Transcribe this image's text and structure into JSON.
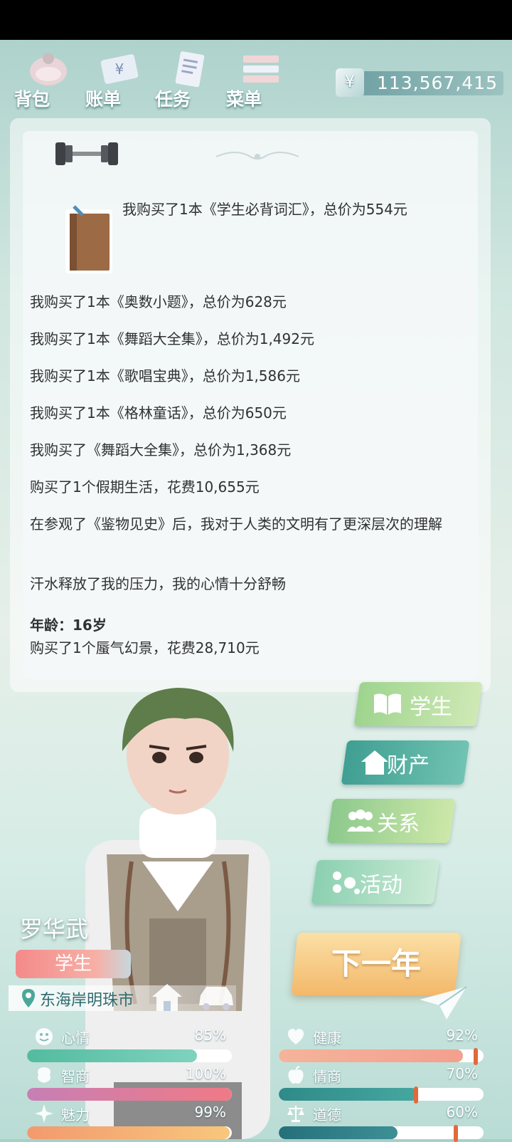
{
  "topbar": {
    "items": [
      {
        "label": "背包",
        "icon": "backpack-icon"
      },
      {
        "label": "账单",
        "icon": "bill-icon"
      },
      {
        "label": "任务",
        "icon": "task-icon"
      },
      {
        "label": "菜单",
        "icon": "menu-icon"
      }
    ],
    "currency_symbol": "¥",
    "money": "113,567,415"
  },
  "log": {
    "entries": [
      "我购买了1本《学生必背词汇》，总价为554元",
      "我购买了1本《奥数小题》，总价为628元",
      "我购买了1本《舞蹈大全集》，总价为1,492元",
      "我购买了1本《歌唱宝典》，总价为1,586元",
      "我购买了1本《格林童话》，总价为650元",
      "我购买了《舞蹈大全集》，总价为1,368元",
      "购买了1个假期生活，花费10,655元",
      "在参观了《鉴物见史》后，我对于人类的文明有了更深层次的理解",
      "汗水释放了我的压力，我的心情十分舒畅"
    ],
    "age": "年龄：16岁",
    "last_entry": "购买了1个蜃气幻景，花费28,710元"
  },
  "side_menu": {
    "student": "学生",
    "assets": "财产",
    "relations": "关系",
    "activity": "活动",
    "next_year": "下一年"
  },
  "character": {
    "name": "罗华武",
    "job": "学生",
    "location": "东海岸明珠市"
  },
  "stats": {
    "mood": {
      "label": "心情",
      "value": "85%"
    },
    "health": {
      "label": "健康",
      "value": "92%"
    },
    "iq": {
      "label": "智商",
      "value": "100%"
    },
    "emotion": {
      "label": "情商",
      "value": "70%"
    },
    "charm": {
      "label": "魅力",
      "value": "99%"
    },
    "morality": {
      "label": "道德",
      "value": "60%"
    }
  },
  "colors": {
    "mood": "#6cc6b0",
    "health": "#f3a08e",
    "iq": "#d47fa0",
    "emotion": "#3d9a96",
    "charm": "#f2a868",
    "morality": "#2f7f86"
  }
}
